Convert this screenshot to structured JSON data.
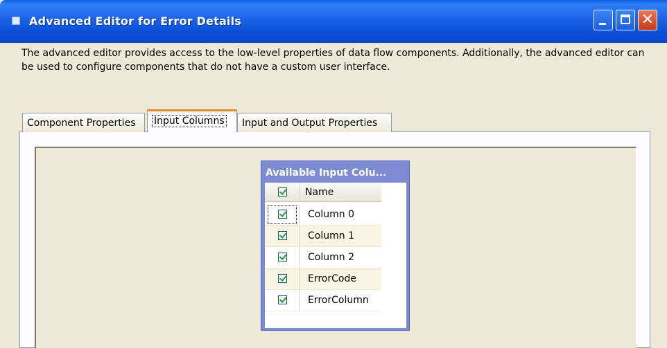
{
  "window": {
    "title": "Advanced Editor for Error Details",
    "minimize_label": "",
    "maximize_label": "",
    "close_label": "✕"
  },
  "description": "The advanced editor provides access to the low-level properties of data flow components. Additionally, the advanced editor can be used to configure components that do not have a custom user interface.",
  "tabs": [
    {
      "label": "Component Properties",
      "active": false
    },
    {
      "label": "Input Columns",
      "active": true
    },
    {
      "label": "Input and Output Properties",
      "active": false
    }
  ],
  "input_columns_panel": {
    "title": "Available Input Colu...",
    "header": {
      "checked": true,
      "label": "Name"
    },
    "rows": [
      {
        "checked": true,
        "label": "Column 0"
      },
      {
        "checked": true,
        "label": "Column 1"
      },
      {
        "checked": true,
        "label": "Column 2"
      },
      {
        "checked": true,
        "label": "ErrorCode"
      },
      {
        "checked": true,
        "label": "ErrorColumn"
      }
    ]
  },
  "colors": {
    "titlebar": "#0b4fd6",
    "active_tab_accent": "#e68b2c",
    "panel_header": "#7d8cd0",
    "checkmark": "#21a121"
  }
}
